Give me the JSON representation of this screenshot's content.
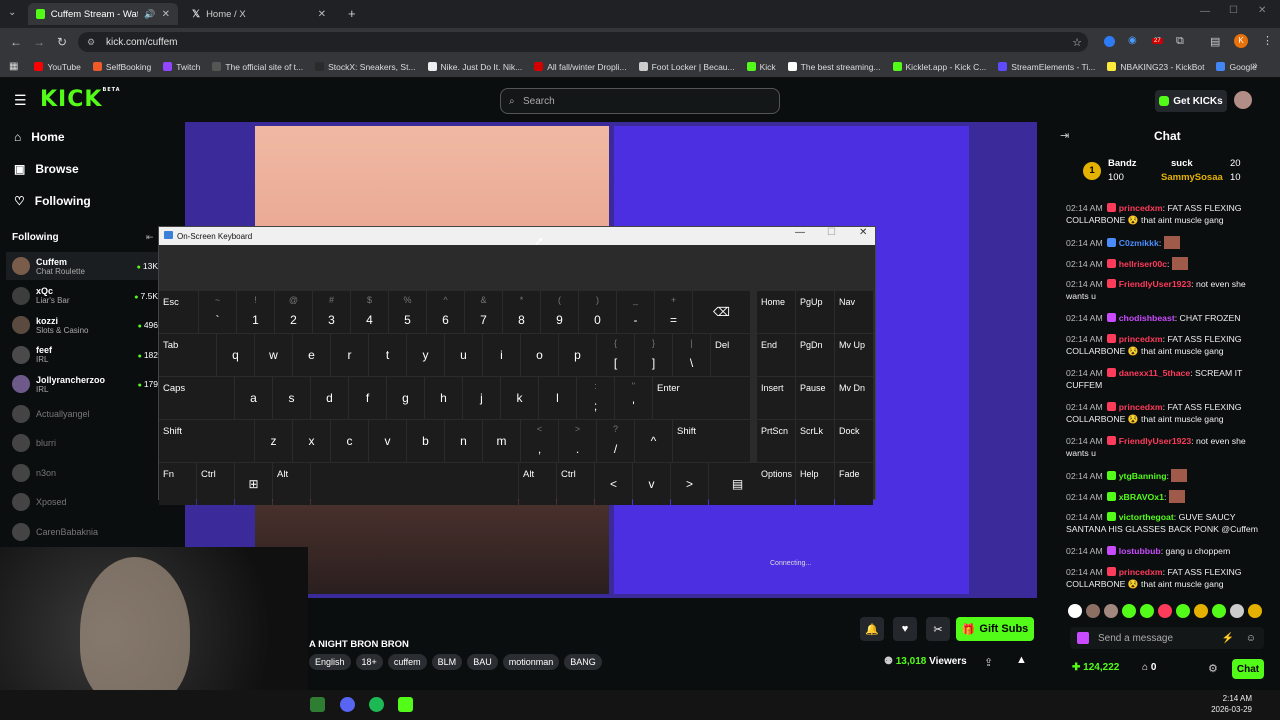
{
  "browser": {
    "tabs": [
      {
        "label": "Cuffem Stream - Watch Live",
        "active": true
      },
      {
        "label": "Home / X",
        "active": false
      }
    ],
    "url": "kick.com/cuffem",
    "profile_initial": "K",
    "ext_badge": "27",
    "bookmarks": [
      "YouTube",
      "SelfBooking",
      "Twitch",
      "The official site of t...",
      "StockX: Sneakers, St...",
      "Nike. Just Do It. Nik...",
      "All fall/winter Dropli...",
      "Foot Locker | Becau...",
      "Kick",
      "The best streaming...",
      "Kicklet.app - Kick C...",
      "StreamElements - Ti...",
      "NBAKING23 - KickBot",
      "Google"
    ]
  },
  "kick": {
    "logo": "KICK",
    "beta": "BETA",
    "search_placeholder": "Search",
    "get_kicks": "Get KICKs"
  },
  "sidebar": {
    "nav": [
      "Home",
      "Browse",
      "Following"
    ],
    "following_heading": "Following",
    "channels": [
      {
        "name": "Cuffem",
        "category": "Chat Roulette",
        "viewers": "13K",
        "live": true
      },
      {
        "name": "xQc",
        "category": "Liar's Bar",
        "viewers": "7.5K",
        "live": true
      },
      {
        "name": "kozzi",
        "category": "Slots & Casino",
        "viewers": "496",
        "live": true
      },
      {
        "name": "feef",
        "category": "IRL",
        "viewers": "182",
        "live": true
      },
      {
        "name": "Jollyrancherzoo",
        "category": "IRL",
        "viewers": "179",
        "live": true
      },
      {
        "name": "Actuallyangel",
        "live": false
      },
      {
        "name": "blurri",
        "live": false
      },
      {
        "name": "n3on",
        "live": false
      },
      {
        "name": "Xposed",
        "live": false
      },
      {
        "name": "CarenBabaknia",
        "live": false
      }
    ]
  },
  "video": {
    "connecting": "Connecting..."
  },
  "osk": {
    "title": "On-Screen Keyboard",
    "rows": [
      [
        {
          "m": "Esc",
          "w": 40
        },
        {
          "s": "~",
          "m": "`"
        },
        {
          "s": "!",
          "m": "1"
        },
        {
          "s": "@",
          "m": "2"
        },
        {
          "s": "#",
          "m": "3"
        },
        {
          "s": "$",
          "m": "4"
        },
        {
          "s": "%",
          "m": "5"
        },
        {
          "s": "^",
          "m": "6"
        },
        {
          "s": "&",
          "m": "7"
        },
        {
          "s": "*",
          "m": "8"
        },
        {
          "s": "(",
          "m": "9"
        },
        {
          "s": ")",
          "m": "0"
        },
        {
          "s": "_",
          "m": "-"
        },
        {
          "s": "+",
          "m": "="
        },
        {
          "m": "⌫",
          "w": 58
        }
      ],
      [
        {
          "m": "Tab",
          "w": 58
        },
        {
          "m": "q"
        },
        {
          "m": "w"
        },
        {
          "m": "e"
        },
        {
          "m": "r"
        },
        {
          "m": "t"
        },
        {
          "m": "y"
        },
        {
          "m": "u"
        },
        {
          "m": "i"
        },
        {
          "m": "o"
        },
        {
          "m": "p"
        },
        {
          "s": "{",
          "m": "["
        },
        {
          "s": "}",
          "m": "]"
        },
        {
          "s": "|",
          "m": "\\"
        },
        {
          "m": "Del",
          "w": 40
        }
      ],
      [
        {
          "m": "Caps",
          "w": 76
        },
        {
          "m": "a"
        },
        {
          "m": "s"
        },
        {
          "m": "d"
        },
        {
          "m": "f"
        },
        {
          "m": "g"
        },
        {
          "m": "h"
        },
        {
          "m": "j"
        },
        {
          "m": "k"
        },
        {
          "m": "l"
        },
        {
          "s": ":",
          "m": ";"
        },
        {
          "s": "\"",
          "m": "'"
        },
        {
          "m": "Enter",
          "w": 98
        }
      ],
      [
        {
          "m": "Shift",
          "w": 96
        },
        {
          "m": "z"
        },
        {
          "m": "x"
        },
        {
          "m": "c"
        },
        {
          "m": "v"
        },
        {
          "m": "b"
        },
        {
          "m": "n"
        },
        {
          "m": "m"
        },
        {
          "s": "<",
          "m": ","
        },
        {
          "s": ">",
          "m": "."
        },
        {
          "s": "?",
          "m": "/"
        },
        {
          "m": "^"
        },
        {
          "m": "Shift",
          "w": 78
        }
      ],
      [
        {
          "m": "Fn"
        },
        {
          "m": "Ctrl"
        },
        {
          "m": "⊞"
        },
        {
          "m": "Alt"
        },
        {
          "m": "",
          "w": 208
        },
        {
          "m": "Alt"
        },
        {
          "m": "Ctrl"
        },
        {
          "m": "<"
        },
        {
          "m": "v"
        },
        {
          "m": ">"
        },
        {
          "m": "▤",
          "w": 58
        }
      ]
    ],
    "nav_keys": [
      [
        "Home",
        "PgUp",
        "Nav"
      ],
      [
        "End",
        "PgDn",
        "Mv Up"
      ],
      [
        "Insert",
        "Pause",
        "Mv Dn"
      ],
      [
        "PrtScn",
        "ScrLk",
        "Dock"
      ],
      [
        "Options",
        "Help",
        "Fade"
      ]
    ]
  },
  "stream": {
    "title": "A NIGHT BRON BRON",
    "tags": [
      "English",
      "18+",
      "cuffem",
      "BLM",
      "BAU",
      "motionman",
      "BANG"
    ],
    "viewers": "13,018",
    "viewers_label": "Viewers",
    "gift_subs": "Gift Subs"
  },
  "chat": {
    "title": "Chat",
    "pinned": [
      {
        "rank": "1",
        "name": "Bandz",
        "amount": "100",
        "right_name": "suck",
        "right_amount": "20"
      },
      {
        "name": "SammySosaa",
        "amount": "10"
      }
    ],
    "messages": [
      {
        "time": "02:14 AM",
        "user": "princedxm",
        "color": "#ff3b5c",
        "text": "FAT ASS FLEXING COLLARBONE 😵 that aint muscle gang",
        "lines": 2
      },
      {
        "time": "02:14 AM",
        "user": "C0zmikkk",
        "color": "#4a8cff",
        "text": "",
        "lines": 1
      },
      {
        "time": "02:14 AM",
        "user": "hellriser00c",
        "color": "#ff3b5c",
        "text": "",
        "lines": 1
      },
      {
        "time": "02:14 AM",
        "user": "FriendlyUser1923",
        "color": "#ff3b5c",
        "text": "not even she wants u",
        "lines": 2
      },
      {
        "time": "02:14 AM",
        "user": "chodishbeast",
        "color": "#c94bff",
        "text": "CHAT FROZEN",
        "lines": 1
      },
      {
        "time": "02:14 AM",
        "user": "princedxm",
        "color": "#ff3b5c",
        "text": "FAT ASS FLEXING COLLARBONE 😵 that aint muscle gang",
        "lines": 2
      },
      {
        "time": "02:14 AM",
        "user": "danexx11_5thace",
        "color": "#ff3b5c",
        "text": "SCREAM IT CUFFEM",
        "lines": 2
      },
      {
        "time": "02:14 AM",
        "user": "princedxm",
        "color": "#ff3b5c",
        "text": "FAT ASS FLEXING COLLARBONE 😵 that aint muscle gang",
        "lines": 2
      },
      {
        "time": "02:14 AM",
        "user": "FriendlyUser1923",
        "color": "#ff3b5c",
        "text": "not even she wants u",
        "lines": 2
      },
      {
        "time": "02:14 AM",
        "user": "ytgBanning",
        "color": "#53fc18",
        "text": "",
        "lines": 1
      },
      {
        "time": "02:14 AM",
        "user": "xBRAVOx1",
        "color": "#53fc18",
        "text": "",
        "lines": 1
      },
      {
        "time": "02:14 AM",
        "user": "victorthegoat",
        "color": "#53fc18",
        "text": "GUVE SAUCY SANTANA HIS GLASSES BACK PONK @Cuffem",
        "lines": 2
      },
      {
        "time": "02:14 AM",
        "user": "lostubbub",
        "color": "#c94bff",
        "text": "gang u choppem",
        "lines": 1
      },
      {
        "time": "02:14 AM",
        "user": "princedxm",
        "color": "#ff3b5c",
        "text": "FAT ASS FLEXING COLLARBONE 😵 that aint muscle gang",
        "lines": 2
      }
    ],
    "send_placeholder": "Send a message",
    "points": "124,222",
    "count": "0",
    "chat_button": "Chat"
  },
  "taskbar": {
    "time": "2:14 AM",
    "date": "2026-03-29"
  },
  "colors": {
    "kick_green": "#53fc18",
    "overlay_purple": "#4b2fe0"
  }
}
